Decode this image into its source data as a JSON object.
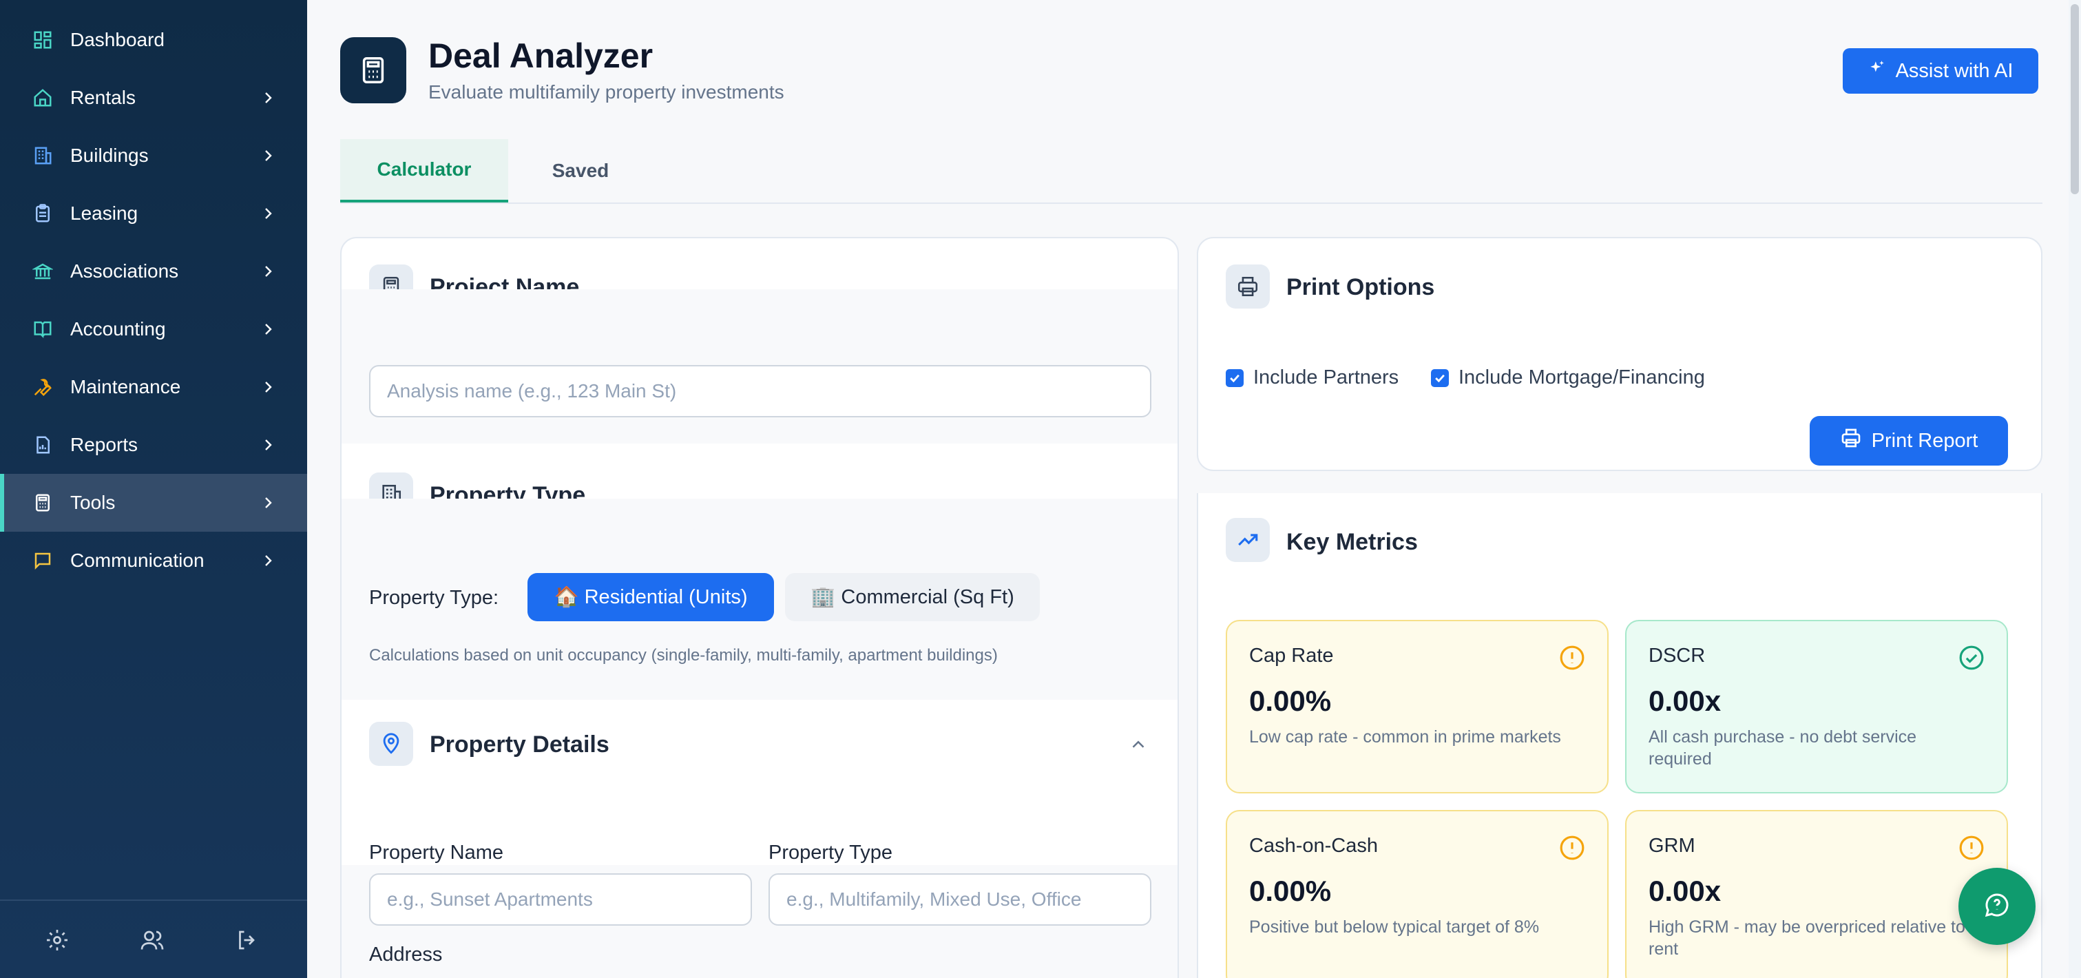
{
  "sidebar": {
    "items": [
      {
        "label": "Dashboard",
        "icon": "dashboard-icon"
      },
      {
        "label": "Rentals",
        "icon": "home-icon"
      },
      {
        "label": "Buildings",
        "icon": "building-icon"
      },
      {
        "label": "Leasing",
        "icon": "clipboard-icon"
      },
      {
        "label": "Associations",
        "icon": "bank-icon"
      },
      {
        "label": "Accounting",
        "icon": "book-icon"
      },
      {
        "label": "Maintenance",
        "icon": "wrench-icon"
      },
      {
        "label": "Reports",
        "icon": "report-icon"
      },
      {
        "label": "Tools",
        "icon": "calculator-icon"
      },
      {
        "label": "Communication",
        "icon": "chat-icon"
      }
    ],
    "active_item": "Tools",
    "footer_icons": [
      "gear-icon",
      "users-icon",
      "logout-icon"
    ]
  },
  "header": {
    "title": "Deal Analyzer",
    "subtitle": "Evaluate multifamily property investments",
    "ai_button_label": "Assist with AI"
  },
  "tabs": [
    {
      "label": "Calculator",
      "active": true
    },
    {
      "label": "Saved",
      "active": false
    }
  ],
  "left_card": {
    "project": {
      "title": "Project Name",
      "input_placeholder": "Analysis name (e.g., 123 Main St)",
      "input_value": ""
    },
    "property_type": {
      "title": "Property Type",
      "label": "Property Type:",
      "options": [
        "🏠 Residential (Units)",
        "🏢 Commercial (Sq Ft)"
      ],
      "selected": "🏠 Residential (Units)",
      "hint": "Calculations based on unit occupancy (single-family, multi-family, apartment buildings)"
    },
    "property_details": {
      "title": "Property Details",
      "property_name_label": "Property Name",
      "property_name_placeholder": "e.g., Sunset Apartments",
      "property_type_label": "Property Type",
      "property_type_placeholder": "e.g., Multifamily, Mixed Use, Office",
      "address_label": "Address"
    }
  },
  "print_options": {
    "title": "Print Options",
    "checkboxes": [
      {
        "label": "Include Partners",
        "checked": true
      },
      {
        "label": "Include Mortgage/Financing",
        "checked": true
      }
    ],
    "print_button_label": "Print Report"
  },
  "key_metrics": {
    "title": "Key Metrics",
    "metrics": [
      {
        "name": "Cap Rate",
        "value": "0.00%",
        "desc": "Low cap rate - common in prime markets",
        "status": "warning"
      },
      {
        "name": "DSCR",
        "value": "0.00x",
        "desc": "All cash purchase - no debt service required",
        "status": "good"
      },
      {
        "name": "Cash-on-Cash",
        "value": "0.00%",
        "desc": "Positive but below typical target of 8%",
        "status": "warning"
      },
      {
        "name": "GRM",
        "value": "0.00x",
        "desc": "High GRM - may be overpriced relative to rent",
        "status": "warning"
      }
    ]
  },
  "colors": {
    "sidebar_bg": "#0f2b46",
    "accent_teal": "#4ad6c6",
    "primary_blue": "#1d6df0",
    "tab_green": "#0c8f62",
    "warning_amber": "#f5a40c",
    "good_green": "#16a37a"
  }
}
